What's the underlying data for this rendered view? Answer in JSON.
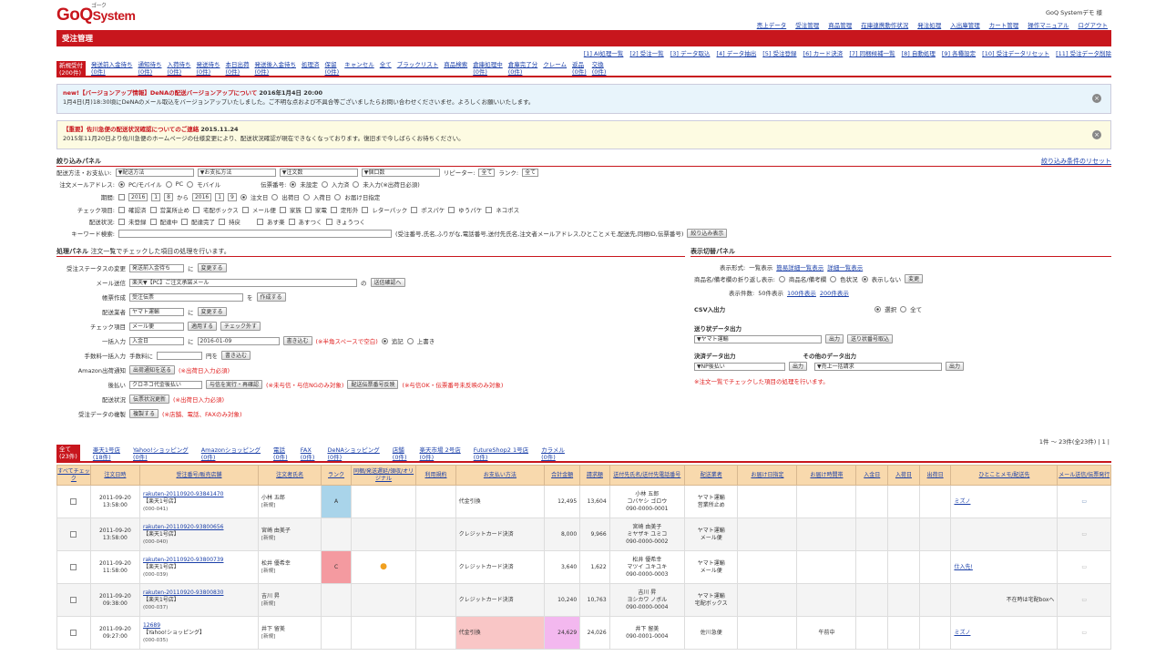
{
  "app": {
    "logo_main": "GoQ",
    "logo_sub": "System",
    "logo_ruby": "ゴーク",
    "user": "GoQ Systemデモ 様"
  },
  "topnav": [
    "売上データ",
    "受注管理",
    "商品管理",
    "在庫連携動作状況",
    "発注処理",
    "入出庫管理",
    "カート管理",
    "操作マニュアル",
    "ログアウト"
  ],
  "page_title": "受注管理",
  "numnav": [
    "[1] AI処理一覧",
    "[2] 受注一覧",
    "[3] データ取込",
    "[4] データ抽出",
    "[5] 受注登録",
    "[6] カード決済",
    "[7] 同梱候補一覧",
    "[8] 自動処理",
    "[9] 各種設定",
    "[10] 受注データリセット",
    "[11] 受注データ削除"
  ],
  "status_tabs": [
    {
      "label": "新規受付",
      "count": "(200件)"
    },
    {
      "label": "発送前入金待ち",
      "count": "(0件)"
    },
    {
      "label": "通知待ち",
      "count": "(0件)"
    },
    {
      "label": "入荷待ち",
      "count": "(0件)"
    },
    {
      "label": "発送待ち",
      "count": "(0件)"
    },
    {
      "label": "本日出荷",
      "count": "(0件)"
    },
    {
      "label": "発送後入金待ち",
      "count": "(0件)"
    },
    {
      "label": "処理済",
      "count": ""
    },
    {
      "label": "保留",
      "count": "(0件)"
    },
    {
      "label": "キャンセル",
      "count": ""
    },
    {
      "label": "全て",
      "count": ""
    },
    {
      "label": "ブラックリスト",
      "count": ""
    },
    {
      "label": "商品検索",
      "count": ""
    },
    {
      "label": "倉庫処理中",
      "count": "(0件)"
    },
    {
      "label": "倉庫完了分",
      "count": "(0件)"
    },
    {
      "label": "クレーム",
      "count": ""
    },
    {
      "label": "返品",
      "count": "(0件)"
    },
    {
      "label": "交換",
      "count": "(0件)"
    }
  ],
  "notice1": {
    "title": "new!【バージョンアップ情報】DeNAの配送バージョンアップについて",
    "date": "2016年1月4日 20:00",
    "body": "1月4日(月)18:30頃にDeNAのメール取込をバージョンアップいたしました。ご不明な点および不具合等ございましたらお問い合わせくださいませ。よろしくお願いいたします。"
  },
  "notice2": {
    "title": "【重要】佐川急便の配送状況確認についてのご連絡",
    "date": "2015.11.24",
    "body": "2015年11月20日より佐川急便のホームページの仕様変更により、配送状況確認が現在できなくなっております。復旧まで今しばらくお待ちください。"
  },
  "filter": {
    "heading": "絞り込みパネル",
    "reset": "絞り込み条件のリセット",
    "r1_label": "配送方法・お支払い:",
    "r1_selects": [
      "▼配送方法",
      "▼お支払方法",
      "▼注文数",
      "▼個口数"
    ],
    "repeater": "リピーター:",
    "repeater_val": "全て",
    "rank": "ランク:",
    "rank_val": "全て",
    "r2_label": "注文メールアドレス:",
    "r2_opts": [
      "PC/モバイル",
      "PC",
      "モバイル"
    ],
    "r2_b": "伝票番号:",
    "r2_b_opts": [
      "未設定",
      "入力済",
      "未入力(※出荷日必須)"
    ],
    "r3_label": "期間:",
    "y1": "2016",
    "m1": "1",
    "d1": "8",
    "y2": "2016",
    "m2": "1",
    "d2": "9",
    "r3_opts": [
      "注文日",
      "出荷日",
      "入荷日",
      "お届け日指定"
    ],
    "r4_label": "チェック項目:",
    "r4_opts": [
      "確認済",
      "営業所止め",
      "宅配ボックス",
      "メール便",
      "家族",
      "家電",
      "定形外",
      "レターパック",
      "ポスパケ",
      "ゆうパケ",
      "ネコポス"
    ],
    "r5_label": "配送状況:",
    "r5_opts": [
      "未登録",
      "配達中",
      "配達完了",
      "持戻",
      "あす楽",
      "あすつく",
      "きょうつく"
    ],
    "r6_label": "キーワード検索:",
    "r6_hint": "(受注番号,氏名,ふりがな,電話番号,送付先氏名,注文者メールアドレス,ひとことメモ,配送先,同梱ID,伝票番号)",
    "r6_btn": "絞り込み表示"
  },
  "process": {
    "heading": "処理パネル",
    "sub": "注文一覧でチェックした項目の処理を行います。",
    "rows": [
      {
        "label": "受注ステータスの変更",
        "ctrl": "発送前入金待ち",
        "suffix": "に",
        "btn": "変更する"
      },
      {
        "label": "メール送信",
        "ctrl": "楽天▼【PC】ご注文承諾メール",
        "suffix": "の",
        "btn": "送信確認へ"
      },
      {
        "label": "帳票作成",
        "ctrl": "受注伝票",
        "suffix": "を",
        "btn": "作成する"
      },
      {
        "label": "配送業者",
        "ctrl": "ヤマト運輸",
        "suffix": "に",
        "btn": "変更する"
      },
      {
        "label": "チェック項目",
        "ctrl": "メール便",
        "suffix": "",
        "btn": "適用する",
        "btn2": "チェック外す"
      },
      {
        "label": "一括入力",
        "ctrl": "入金日",
        "suffix": "に",
        "input": "2016-01-09",
        "btn": "書き込む",
        "note": "(※半角スペースで空白)",
        "opts": [
          "追記",
          "上書き"
        ]
      },
      {
        "label": "手数料一括入力",
        "ctrl": "手数料に",
        "suffix": "円を",
        "btn": "書き込む"
      },
      {
        "label": "Amazon出荷通知",
        "ctrl": "",
        "suffix": "",
        "btn": "出荷通知を送る",
        "note": "(※出荷日入力必須)"
      },
      {
        "label": "後払い",
        "ctrl": "クロネコ代金後払い",
        "suffix": "",
        "btn": "与信を実行・再確認",
        "note": "(※未与信・与信NGのみ対象)",
        "btn2": "配送伝票番号反映",
        "note2": "(※与信OK・伝票番号未反映のみ対象)"
      },
      {
        "label": "配送状況",
        "ctrl": "",
        "suffix": "",
        "btn": "伝票状況更新",
        "note": "(※出荷日入力必須)"
      },
      {
        "label": "受注データの複製",
        "ctrl": "",
        "suffix": "",
        "btn": "複製する",
        "note": "(※店舗、電話、FAXのみ対象)"
      }
    ]
  },
  "display": {
    "heading": "表示切替パネル",
    "fmt_label": "表示形式:",
    "fmt_cur": "一覧表示",
    "fmt_links": [
      "簡易詳細一覧表示",
      "詳細一覧表示"
    ],
    "item_label": "商品名/備考欄の折り返し表示:",
    "item_opts": [
      "商品名/備考欄",
      "色状況",
      "表示しない"
    ],
    "item_btn": "変更",
    "count_label": "表示件数:",
    "count_cur": "50件表示",
    "count_links": [
      "100件表示",
      "200件表示"
    ],
    "csv_label": "CSV入出力",
    "csv_opts": [
      "選択",
      "全て"
    ],
    "ship_label": "送り状データ出力",
    "ship_sel": "▼ヤマト運輸",
    "ship_btn": "出力",
    "ship_btn2": "送り状番号取込",
    "pay_label": "決済データ出力",
    "pay_sel": "▼NP後払い",
    "pay_btn": "出力",
    "other_label": "その他のデータ出力",
    "other_sel": "▼売上一括請求",
    "other_btn": "出力",
    "note": "※注文一覧でチェックした項目の処理を行います。"
  },
  "channels": [
    {
      "label": "全て",
      "count": "(23件)"
    },
    {
      "label": "楽天1号店",
      "count": "(18件)"
    },
    {
      "label": "Yahoo!ショッピング",
      "count": "(0件)"
    },
    {
      "label": "Amazonショッピング",
      "count": "(0件)"
    },
    {
      "label": "電話",
      "count": "(0件)"
    },
    {
      "label": "FAX",
      "count": "(0件)"
    },
    {
      "label": "DeNAショッピング",
      "count": "(0件)"
    },
    {
      "label": "店舗",
      "count": "(0件)"
    },
    {
      "label": "楽天市場 2号店",
      "count": "(0件)"
    },
    {
      "label": "FutureShop2 1号店",
      "count": "(0件)"
    },
    {
      "label": "カラメル",
      "count": "(0件)"
    }
  ],
  "pager": "1件 ～ 23件(全23件) | 1 |",
  "columns": [
    "すべてチェック",
    "注文日時",
    "受注番号/販売店舗",
    "注文者氏名",
    "ランク",
    "同梱/発送遅延/領収/オリジナル",
    "利用規約",
    "お支払い方法",
    "合計金額",
    "請求額",
    "送付先氏名/送付先電話番号",
    "配送業者",
    "お届け日指定",
    "お届け時間帯",
    "入金日",
    "入荷日",
    "出荷日",
    "ひとことメモ/配送先",
    "メール送信/伝票発行"
  ],
  "rows": [
    {
      "date": "2011-09-20",
      "time": "13:58:00",
      "order": "rakuten-20110920-93841470",
      "shop": "【楽天1号店】",
      "id": "(000-041)",
      "name": "小林 五郎",
      "sub": "[新規]",
      "rank": "A",
      "pay": "代金引換",
      "total": "12,495",
      "bill": "13,604",
      "ship_name": "小林 五郎",
      "ship_kana": "コバヤシ ゴロウ",
      "ship_tel": "090-0000-0001",
      "carrier": "ヤマト運輸",
      "carrier2": "営業所止め",
      "memo": "ミズノ",
      "mark": ""
    },
    {
      "date": "2011-09-20",
      "time": "13:58:00",
      "order": "rakuten-20110920-93800656",
      "shop": "【楽天1号店】",
      "id": "(000-040)",
      "name": "宮崎 由美子",
      "sub": "[新規]",
      "rank": "",
      "pay": "クレジットカード決済",
      "total": "8,000",
      "bill": "9,966",
      "ship_name": "宮崎 由美子",
      "ship_kana": "ミヤザキ ユミコ",
      "ship_tel": "090-0000-0002",
      "carrier": "ヤマト運輸",
      "carrier2": "メール便",
      "memo": "",
      "mark": ""
    },
    {
      "date": "2011-09-20",
      "time": "11:58:00",
      "order": "rakuten-20110920-93800739",
      "shop": "【楽天1号店】",
      "id": "(000-039)",
      "name": "松井 優希幸",
      "sub": "[新規]",
      "rank": "C",
      "pay": "クレジットカード決済",
      "total": "3,640",
      "bill": "1,622",
      "ship_name": "松井 優希幸",
      "ship_kana": "マツイ ユキユキ",
      "ship_tel": "090-0000-0003",
      "carrier": "ヤマト運輸",
      "carrier2": "メール便",
      "memo": "仕入先!",
      "mark": "●"
    },
    {
      "date": "2011-09-20",
      "time": "09:38:00",
      "order": "rakuten-20110920-93800830",
      "shop": "【楽天1号店】",
      "id": "(000-037)",
      "name": "吉川 昇",
      "sub": "[新規]",
      "rank": "",
      "pay": "クレジットカード決済",
      "total": "10,240",
      "bill": "10,763",
      "ship_name": "吉川 昇",
      "ship_kana": "ヨシカワ ノボル",
      "ship_tel": "090-0000-0004",
      "carrier": "ヤマト運輸",
      "carrier2": "宅配ボックス",
      "memo": "不在時は宅配boxへ",
      "mark": ""
    },
    {
      "date": "2011-09-20",
      "time": "09:27:00",
      "order": "12689",
      "shop": "【Yahoo!ショッピング】",
      "id": "(000-035)",
      "name": "井下 留美",
      "sub": "[新規]",
      "rank": "",
      "pay": "代金引換",
      "total": "24,629",
      "bill": "24,026",
      "ship_name": "井下 留美",
      "ship_kana": "",
      "ship_tel": "090-0001-0004",
      "carrier": "佐川急便",
      "carrier2": "",
      "memo": "ミズノ",
      "mark": "",
      "time_slot": "午前中"
    }
  ]
}
